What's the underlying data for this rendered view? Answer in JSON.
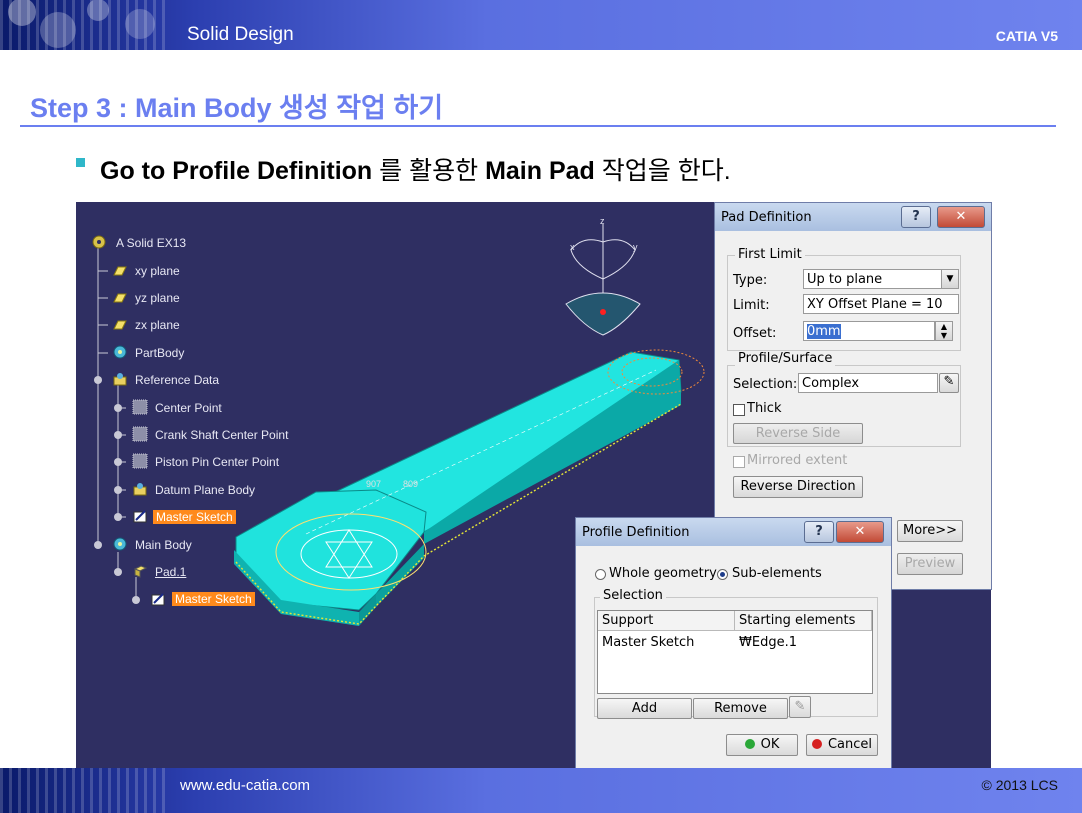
{
  "header": {
    "title": "Solid Design",
    "right_label": "CATIA V5"
  },
  "slide": {
    "title": "Step 3 : Main Body 생성 작업 하기",
    "bullet": {
      "bold1": "Go to Profile Definition",
      "mid": " 를 활용한 ",
      "bold2": "Main Pad",
      "end": " 작업을 한다."
    }
  },
  "tree": {
    "items": [
      {
        "label": "A Solid EX13",
        "icon": "part-gear-icon"
      },
      {
        "label": "xy plane",
        "icon": "plane-icon"
      },
      {
        "label": "yz plane",
        "icon": "plane-icon"
      },
      {
        "label": "zx plane",
        "icon": "plane-icon"
      },
      {
        "label": "PartBody",
        "icon": "body-gear-icon"
      },
      {
        "label": "Reference Data",
        "icon": "geometrical-set-icon"
      },
      {
        "label": "Center Point",
        "icon": "point-icon"
      },
      {
        "label": "Crank Shaft Center Point",
        "icon": "point-icon"
      },
      {
        "label": "Piston Pin Center Point",
        "icon": "point-icon"
      },
      {
        "label": "Datum Plane Body",
        "icon": "geometrical-set-icon"
      },
      {
        "label": "Master Sketch",
        "icon": "sketch-icon",
        "selected": true
      },
      {
        "label": "Main Body",
        "icon": "body-gear-icon"
      },
      {
        "label": "Pad.1",
        "icon": "pad-icon"
      },
      {
        "label": "Master Sketch",
        "icon": "sketch-icon",
        "selected": true
      }
    ]
  },
  "viewport": {
    "dim_label_1": "907",
    "dim_label_2": "809",
    "compass_axis_z": "z",
    "compass_axis_x": "x",
    "compass_axis_y": "y"
  },
  "pad_dialog": {
    "title": "Pad Definition",
    "first_limit": {
      "group_label": "First Limit",
      "type_label": "Type:",
      "type_value": "Up to plane",
      "limit_label": "Limit:",
      "limit_value": "XY Offset Plane = 10",
      "offset_label": "Offset:",
      "offset_value": "0mm"
    },
    "profile_surface": {
      "group_label": "Profile/Surface",
      "selection_label": "Selection:",
      "selection_value": "Complex",
      "thick_label": "Thick",
      "reverse_side_label": "Reverse Side"
    },
    "mirrored_extent_label": "Mirrored extent",
    "reverse_direction_label": "Reverse Direction",
    "more_label": "More>>",
    "preview_label": "Preview"
  },
  "profile_dialog": {
    "title": "Profile Definition",
    "whole_geometry_label": "Whole geometry",
    "sub_elements_label": "Sub-elements",
    "selected_mode": "sub-elements",
    "selection_group_label": "Selection",
    "columns": [
      "Support",
      "Starting elements"
    ],
    "rows": [
      {
        "support": "Master Sketch",
        "starting": "₩Edge.1"
      }
    ],
    "add_label": "Add",
    "remove_label": "Remove",
    "ok_label": "OK",
    "cancel_label": "Cancel"
  },
  "footer": {
    "url": "www.edu-catia.com",
    "copyright": "© 2013 LCS"
  },
  "colors": {
    "accent_title": "#6b7ff0",
    "viewport_bg": "#2f2f62",
    "part_face": "#22e0dc",
    "tree_selection": "#ff8a1c",
    "bullet_square": "#2fb7c9"
  }
}
